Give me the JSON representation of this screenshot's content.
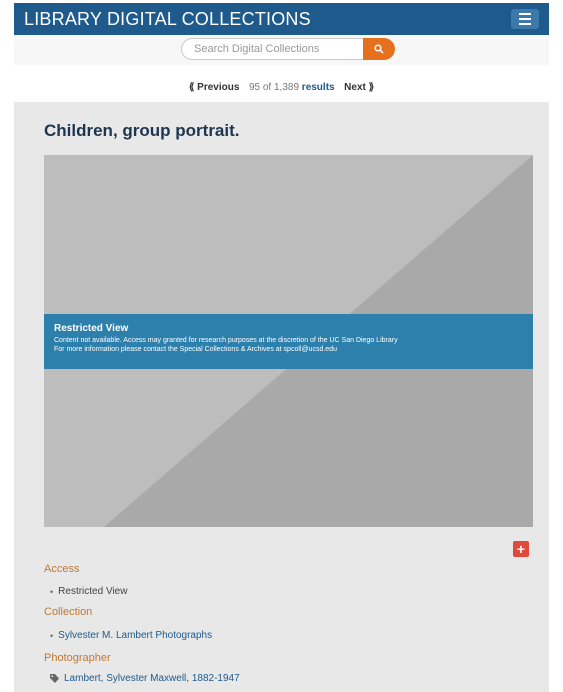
{
  "header": {
    "title": "LIBRARY DIGITAL COLLECTIONS",
    "menu_icon": "hamburger-icon"
  },
  "search": {
    "placeholder": "Search Digital Collections",
    "button_icon": "search-icon"
  },
  "pager": {
    "previous_label": "Previous",
    "position_text": "95 of 1,389",
    "results_label": "results",
    "next_label": "Next"
  },
  "record": {
    "title": "Children, group portrait."
  },
  "restricted": {
    "title": "Restricted View",
    "line1": "Content not available. Access may granted for research purposes at the discretion of the UC San Diego Library",
    "line2": "For more information please contact the Special Collections & Archives at spcoll@ucsd.edu"
  },
  "fields": {
    "access_label": "Access",
    "access_value": "Restricted View",
    "collection_label": "Collection",
    "collection_value": "Sylvester M. Lambert Photographs",
    "photographer_label": "Photographer",
    "photographer_value": "Lambert, Sylvester Maxwell, 1882-1947"
  },
  "colors": {
    "header_bg": "#1e5a8c",
    "search_button": "#e5711f",
    "restricted_banner": "#2d7fac",
    "label_orange": "#c27832",
    "plus_button": "#e04a3a"
  }
}
